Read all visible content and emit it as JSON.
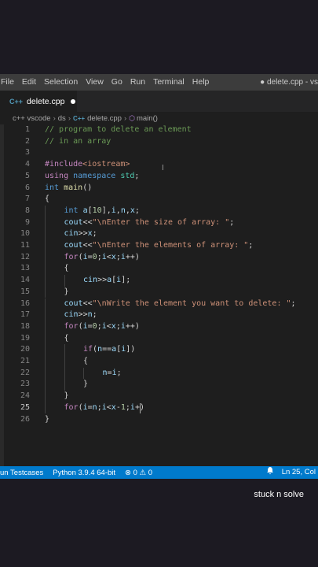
{
  "menubar": {
    "items": [
      "File",
      "Edit",
      "Selection",
      "View",
      "Go",
      "Run",
      "Terminal",
      "Help"
    ],
    "window_title": "● delete.cpp - vs"
  },
  "tab": {
    "icon": "C++",
    "label": "delete.cpp"
  },
  "breadcrumb": {
    "items": [
      "c++ vscode",
      "ds",
      "delete.cpp",
      "main()"
    ],
    "file_icon": "C++",
    "function_icon": "⬡"
  },
  "editor": {
    "cursor_line": 25,
    "lines": [
      {
        "n": "1",
        "indent": 0,
        "tokens": [
          [
            "// program to delete an element",
            "comment"
          ]
        ]
      },
      {
        "n": "2",
        "indent": 0,
        "tokens": [
          [
            "// in an array",
            "comment"
          ]
        ]
      },
      {
        "n": "3",
        "indent": 0,
        "tokens": []
      },
      {
        "n": "4",
        "indent": 0,
        "tokens": [
          [
            "#include",
            "ctrl"
          ],
          [
            "<iostream>",
            "str"
          ]
        ]
      },
      {
        "n": "5",
        "indent": 0,
        "tokens": [
          [
            "using",
            "ctrl"
          ],
          [
            " ",
            "id"
          ],
          [
            "namespace",
            "kw"
          ],
          [
            " ",
            "id"
          ],
          [
            "std",
            "ns"
          ],
          [
            ";",
            "id"
          ]
        ]
      },
      {
        "n": "6",
        "indent": 0,
        "tokens": [
          [
            "int",
            "kw"
          ],
          [
            " ",
            "id"
          ],
          [
            "main",
            "fn"
          ],
          [
            "()",
            "id"
          ]
        ]
      },
      {
        "n": "7",
        "indent": 0,
        "tokens": [
          [
            "{",
            "id"
          ]
        ]
      },
      {
        "n": "8",
        "indent": 1,
        "tokens": [
          [
            "int",
            "kw"
          ],
          [
            " ",
            "id"
          ],
          [
            "a",
            "var"
          ],
          [
            "[",
            "id"
          ],
          [
            "10",
            "num"
          ],
          [
            "],",
            "id"
          ],
          [
            "i",
            "var"
          ],
          [
            ",",
            "id"
          ],
          [
            "n",
            "var"
          ],
          [
            ",",
            "id"
          ],
          [
            "x",
            "var"
          ],
          [
            ";",
            "id"
          ]
        ]
      },
      {
        "n": "9",
        "indent": 1,
        "tokens": [
          [
            "cout",
            "var"
          ],
          [
            "<<",
            "id"
          ],
          [
            "\"\\nEnter the size of array: \"",
            "str"
          ],
          [
            ";",
            "id"
          ]
        ]
      },
      {
        "n": "10",
        "indent": 1,
        "tokens": [
          [
            "cin",
            "var"
          ],
          [
            ">>",
            "id"
          ],
          [
            "x",
            "var"
          ],
          [
            ";",
            "id"
          ]
        ]
      },
      {
        "n": "11",
        "indent": 1,
        "tokens": [
          [
            "cout",
            "var"
          ],
          [
            "<<",
            "id"
          ],
          [
            "\"\\nEnter the elements of array: \"",
            "str"
          ],
          [
            ";",
            "id"
          ]
        ]
      },
      {
        "n": "12",
        "indent": 1,
        "tokens": [
          [
            "for",
            "ctrl"
          ],
          [
            "(",
            "id"
          ],
          [
            "i",
            "var"
          ],
          [
            "=",
            "id"
          ],
          [
            "0",
            "num"
          ],
          [
            ";",
            "id"
          ],
          [
            "i",
            "var"
          ],
          [
            "<",
            "id"
          ],
          [
            "x",
            "var"
          ],
          [
            ";",
            "id"
          ],
          [
            "i",
            "var"
          ],
          [
            "++)",
            "id"
          ]
        ]
      },
      {
        "n": "13",
        "indent": 1,
        "tokens": [
          [
            "{",
            "id"
          ]
        ]
      },
      {
        "n": "14",
        "indent": 2,
        "tokens": [
          [
            "cin",
            "var"
          ],
          [
            ">>",
            "id"
          ],
          [
            "a",
            "var"
          ],
          [
            "[",
            "id"
          ],
          [
            "i",
            "var"
          ],
          [
            "];",
            "id"
          ]
        ]
      },
      {
        "n": "15",
        "indent": 1,
        "tokens": [
          [
            "}",
            "id"
          ]
        ]
      },
      {
        "n": "16",
        "indent": 1,
        "tokens": [
          [
            "cout",
            "var"
          ],
          [
            "<<",
            "id"
          ],
          [
            "\"\\nWrite the element you want to delete: \"",
            "str"
          ],
          [
            ";",
            "id"
          ]
        ]
      },
      {
        "n": "17",
        "indent": 1,
        "tokens": [
          [
            "cin",
            "var"
          ],
          [
            ">>",
            "id"
          ],
          [
            "n",
            "var"
          ],
          [
            ";",
            "id"
          ]
        ]
      },
      {
        "n": "18",
        "indent": 1,
        "tokens": [
          [
            "for",
            "ctrl"
          ],
          [
            "(",
            "id"
          ],
          [
            "i",
            "var"
          ],
          [
            "=",
            "id"
          ],
          [
            "0",
            "num"
          ],
          [
            ";",
            "id"
          ],
          [
            "i",
            "var"
          ],
          [
            "<",
            "id"
          ],
          [
            "x",
            "var"
          ],
          [
            ";",
            "id"
          ],
          [
            "i",
            "var"
          ],
          [
            "++)",
            "id"
          ]
        ]
      },
      {
        "n": "19",
        "indent": 1,
        "tokens": [
          [
            "{",
            "id"
          ]
        ]
      },
      {
        "n": "20",
        "indent": 2,
        "tokens": [
          [
            "if",
            "ctrl"
          ],
          [
            "(",
            "id"
          ],
          [
            "n",
            "var"
          ],
          [
            "==",
            "id"
          ],
          [
            "a",
            "var"
          ],
          [
            "[",
            "id"
          ],
          [
            "i",
            "var"
          ],
          [
            "])",
            "id"
          ]
        ]
      },
      {
        "n": "21",
        "indent": 2,
        "tokens": [
          [
            "{",
            "id"
          ]
        ]
      },
      {
        "n": "22",
        "indent": 3,
        "tokens": [
          [
            "n",
            "var"
          ],
          [
            "=",
            "id"
          ],
          [
            "i",
            "var"
          ],
          [
            ";",
            "id"
          ]
        ]
      },
      {
        "n": "23",
        "indent": 2,
        "tokens": [
          [
            "}",
            "id"
          ]
        ]
      },
      {
        "n": "24",
        "indent": 1,
        "tokens": [
          [
            "}",
            "id"
          ]
        ]
      },
      {
        "n": "25",
        "indent": 1,
        "tokens": [
          [
            "for",
            "ctrl"
          ],
          [
            "(",
            "id"
          ],
          [
            "i",
            "var"
          ],
          [
            "=",
            "id"
          ],
          [
            "n",
            "var"
          ],
          [
            ";",
            "id"
          ],
          [
            "i",
            "var"
          ],
          [
            "<",
            "id"
          ],
          [
            "x",
            "var"
          ],
          [
            "-",
            "id"
          ],
          [
            "1",
            "num"
          ],
          [
            ";",
            "id"
          ],
          [
            "i",
            "var"
          ],
          [
            "+",
            "id"
          ],
          [
            ")",
            "id"
          ]
        ]
      },
      {
        "n": "26",
        "indent": 0,
        "tokens": [
          [
            "}",
            "id"
          ]
        ]
      }
    ]
  },
  "statusbar": {
    "run_testcases": "un Testcases",
    "python": "Python 3.9.4 64-bit",
    "problems": "⊗ 0 ⚠ 0",
    "bell_icon": "bell-icon",
    "position": "Ln 25, Col"
  },
  "caption": "stuck n solve",
  "colors": {
    "editor_bg": "#1e1e1e",
    "statusbar_bg": "#007acc",
    "menubar_bg": "#3c3c3c",
    "comment": "#6a9955",
    "keyword": "#569cd6",
    "control": "#c586c0",
    "string": "#ce9178"
  }
}
